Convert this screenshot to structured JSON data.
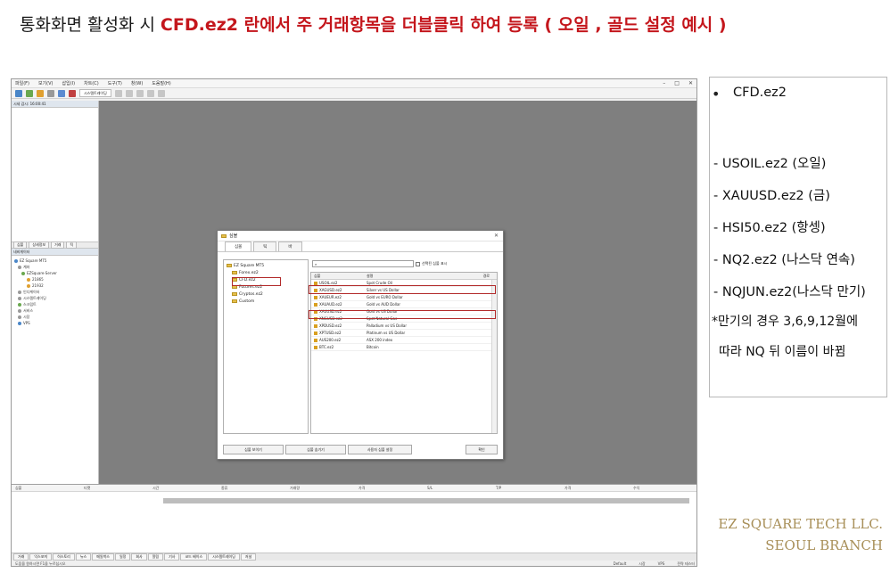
{
  "header": {
    "prefix": "통화화면 활성화 시",
    "highlight": "CFD.ez2 란에서 주 거래항목을 더블클릭 하여 등록 ( 오일 , 골드 설정 예시 )"
  },
  "colors": {
    "highlight_red": "#c4161c",
    "chart_bg": "#7f7f7f",
    "brand_gold": "#a88f58",
    "box_red": "#b22a2a"
  },
  "mt5": {
    "menu": [
      "파일(F)",
      "보기(V)",
      "삽입(I)",
      "차트(C)",
      "도구(T)",
      "창(W)",
      "도움말(H)"
    ],
    "toolbar_button": "시스템트레이딩",
    "navigator_header": "네비게이터",
    "market_watch_header": "시세 감시: 16:00:41",
    "left_tabs": [
      "심볼",
      "상세정보",
      "거래",
      "틱"
    ],
    "nav_tree": [
      "EZ Square MT5",
      "계좌",
      "EZSquare-Server",
      "21865",
      "21932",
      "인디케이터",
      "시스템트레이딩",
      "스크립트",
      "서비스",
      "시장",
      "VPS"
    ],
    "bottom_columns": [
      "심볼",
      "티켓",
      "시간",
      "종류",
      "거래량",
      "가격",
      "S/L",
      "T/P",
      "가격",
      "수익"
    ],
    "bottom_tabs": [
      "거래",
      "익스포져",
      "히스토리",
      "뉴스",
      "메일박스",
      "일정",
      "회사",
      "알림",
      "기사",
      "코드 베이스",
      "시스템트레이딩",
      "저널"
    ],
    "status_left": "도움을 원하시면 F1을 누르십시오",
    "status_right": [
      "Default",
      "시장",
      "VPS",
      "전략 테스터"
    ]
  },
  "dialog": {
    "title": "심볼",
    "tabs": [
      "심볼",
      "틱",
      "바"
    ],
    "tree": [
      "EZ Square MT5",
      "Forex.ez2",
      "CFD.ez2",
      "Futures.ez2",
      "Cryptos.ez2",
      "Custom"
    ],
    "search_placeholder": "",
    "checkbox_label": "선택된 심볼 표시",
    "table_headers": [
      "심볼",
      "설명",
      "경로"
    ],
    "rows": [
      {
        "symbol": "USOIL.ez2",
        "description": "Spot Crude Oil"
      },
      {
        "symbol": "XAGUSD.ez2",
        "description": "Silver vs US Dollar"
      },
      {
        "symbol": "XAUEUR.ez2",
        "description": "Gold vs EURO Dollar"
      },
      {
        "symbol": "XAUAUD.ez2",
        "description": "Gold vs AUD Dollar"
      },
      {
        "symbol": "XAUUSD.ez2",
        "description": "Gold vs US Dollar"
      },
      {
        "symbol": "XNGUSD.ez2",
        "description": "Spot Natural Gas"
      },
      {
        "symbol": "XPDUSD.ez2",
        "description": "Palladium vs US Dollar"
      },
      {
        "symbol": "XPTUSD.ez2",
        "description": "Platinum vs US Dollar"
      },
      {
        "symbol": "AUS200.ez2",
        "description": "ASX 200 index"
      },
      {
        "symbol": "BTC.ez2",
        "description": "Bitcoin"
      }
    ],
    "buttons": [
      "심볼 보이기",
      "심볼 숨기기",
      "사용자 심볼 설정",
      "확인"
    ]
  },
  "note": {
    "bullet": "•",
    "title": "CFD.ez2",
    "items": [
      "- USOIL.ez2 (오일)",
      "- XAUUSD.ez2 (금)",
      "- HSI50.ez2 (항셍)",
      "- NQ2.ez2 (나스닥 연속)",
      "- NQJUN.ez2(나스닥 만기)"
    ],
    "footnote_1": "*만기의 경우 3,6,9,12월에",
    "footnote_2": "따라 NQ 뒤 이름이 바뀜"
  },
  "brand": {
    "line1": "EZ SQUARE TECH LLC.",
    "line2": "SEOUL BRANCH"
  }
}
